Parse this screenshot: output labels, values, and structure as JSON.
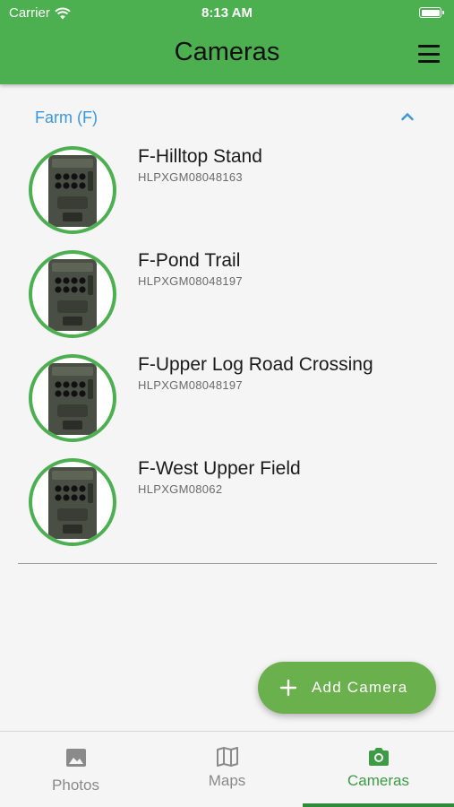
{
  "status_bar": {
    "carrier": "Carrier",
    "time": "8:13 AM"
  },
  "header": {
    "title": "Cameras"
  },
  "section": {
    "title": "Farm (F)"
  },
  "cameras": [
    {
      "name": "F-Hilltop Stand",
      "serial": "HLPXGM08048163"
    },
    {
      "name": "F-Pond Trail",
      "serial": "HLPXGM08048197"
    },
    {
      "name": "F-Upper Log Road Crossing",
      "serial": "HLPXGM08048197"
    },
    {
      "name": "F-West Upper Field",
      "serial": "HLPXGM08062"
    }
  ],
  "fab": {
    "label": "Add Camera"
  },
  "bottom_nav": [
    {
      "label": "Photos",
      "icon": "photo-icon"
    },
    {
      "label": "Maps",
      "icon": "map-icon"
    },
    {
      "label": "Cameras",
      "icon": "camera-icon",
      "active": true
    }
  ],
  "colors": {
    "header": "#4caf50",
    "accent_blue": "#3b96e0",
    "fab": "#6ab04c",
    "nav_active": "#3e9b45"
  }
}
